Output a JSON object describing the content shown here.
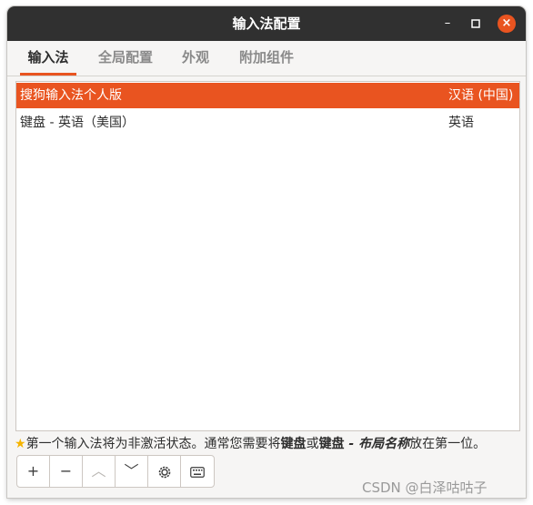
{
  "window": {
    "title": "输入法配置",
    "minimize_glyph": "–",
    "maximize_glyph": "□",
    "close_glyph": "×"
  },
  "tabs": [
    {
      "label": "输入法",
      "active": true
    },
    {
      "label": "全局配置",
      "active": false
    },
    {
      "label": "外观",
      "active": false
    },
    {
      "label": "附加组件",
      "active": false
    }
  ],
  "input_methods": [
    {
      "name": "搜狗输入法个人版",
      "language": "汉语 (中国)",
      "selected": true
    },
    {
      "name": "键盘 - 英语（美国）",
      "language": "英语",
      "selected": false
    }
  ],
  "hint": {
    "star_icon": "star-icon",
    "part1": "第一个输入法将为非激活状态。通常您需要将",
    "bold1": "键盘",
    "part2": "或",
    "bold2": "键盘",
    "italic": " - 布局名称",
    "part3": "放在第一位。"
  },
  "toolbar": {
    "add_glyph": "+",
    "remove_glyph": "−",
    "move_up_glyph": "︿",
    "move_down_glyph": "﹀",
    "configure_icon": "gear-icon",
    "keyboard_icon": "keyboard-icon"
  },
  "watermark": "CSDN @白泽咕咕子",
  "colors": {
    "accent": "#e95420",
    "titlebar": "#303030",
    "window_bg": "#f6f5f4"
  }
}
